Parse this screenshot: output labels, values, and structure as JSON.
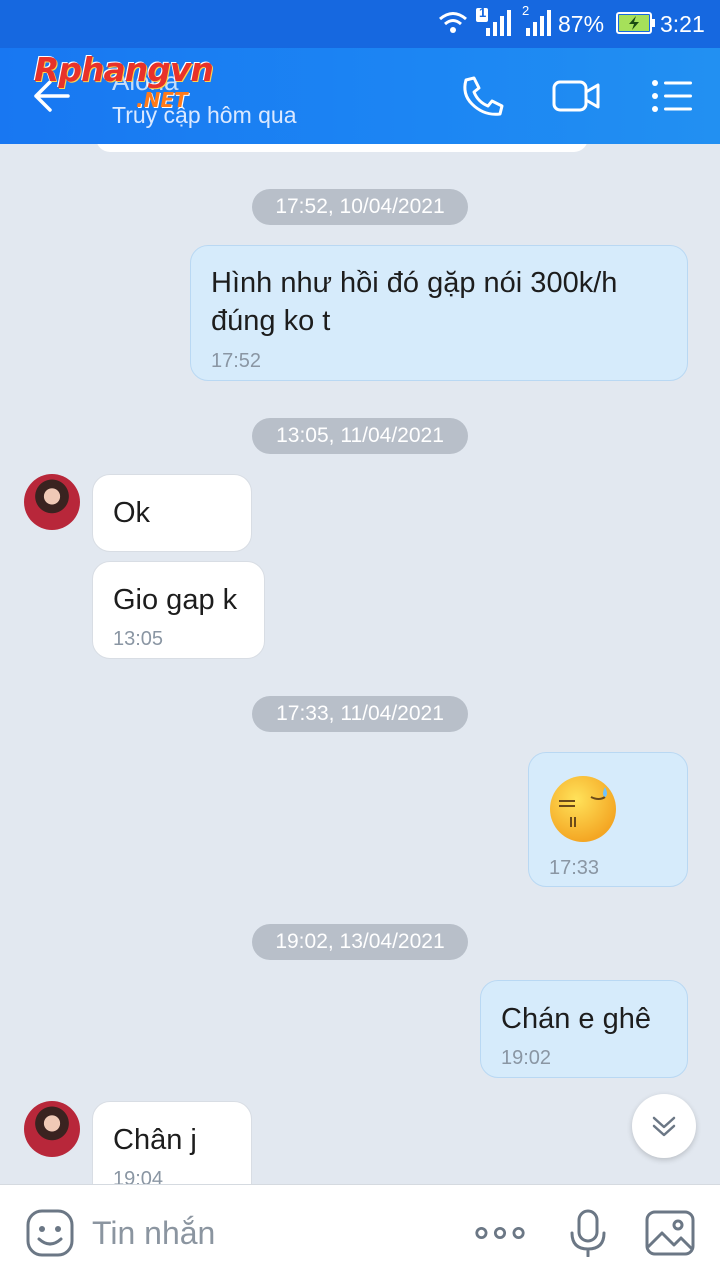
{
  "status_bar": {
    "sim1_badge": "1",
    "sim2_badge": "2",
    "battery": "87%",
    "time": "3:21"
  },
  "header": {
    "contact_name": "Aloha",
    "last_seen": "Truy cập hôm qua",
    "watermark_logo": "Rphangvn",
    "watermark_logo_suffix": ".NET"
  },
  "messages": [
    {
      "type": "date",
      "text": "17:52, 10/04/2021"
    },
    {
      "type": "outgoing",
      "lines": [
        "Hình như hồi đó gặp nói 300k/h",
        "đúng ko t"
      ],
      "time": "17:52"
    },
    {
      "type": "date",
      "text": "13:05, 11/04/2021"
    },
    {
      "type": "incoming",
      "lines": [
        "Ok"
      ],
      "time": ""
    },
    {
      "type": "incoming",
      "lines": [
        "Gio gap k"
      ],
      "time": "13:05"
    },
    {
      "type": "date",
      "text": "17:33, 11/04/2021"
    },
    {
      "type": "outgoing-sticker",
      "sticker": "sweat-face-emoji",
      "time": "17:33"
    },
    {
      "type": "date",
      "text": "19:02, 13/04/2021"
    },
    {
      "type": "outgoing",
      "lines": [
        "Chán e ghê"
      ],
      "time": "19:02"
    },
    {
      "type": "incoming",
      "lines": [
        "Chân j"
      ],
      "time": "19:04"
    }
  ],
  "input_bar": {
    "placeholder": "Tin nhắn"
  },
  "colors": {
    "header": "#1877f2",
    "chat_background": "#e2e8f0",
    "outgoing_bubble": "#d6ebfb",
    "incoming_bubble": "#ffffff"
  }
}
